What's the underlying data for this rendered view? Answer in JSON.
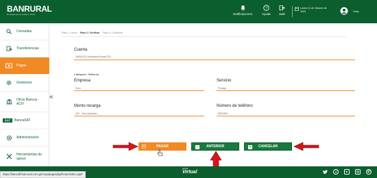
{
  "header": {
    "logo_text": "BANRURAL",
    "logo_tagline": "El amigo que te ayuda a crecer",
    "notifications_label": "Notificaciones",
    "help_label": "Ayuda",
    "logout_label": "Salir",
    "date_text": "Lunes 12 de Octubre de 2020",
    "greeting": "Hola,"
  },
  "sidebar": {
    "items": [
      {
        "label": "Consultas",
        "icon": "search-icon",
        "active": false
      },
      {
        "label": "Transferencias",
        "icon": "transfer-icon",
        "active": false
      },
      {
        "label": "Pagos",
        "icon": "money-icon",
        "active": true
      },
      {
        "label": "Gestiones",
        "icon": "gear-icon",
        "active": false
      },
      {
        "label": "Otros Bancos - ACH",
        "icon": "bank-icon",
        "active": false
      },
      {
        "label": "BancaSAT",
        "icon": "sat-logo-icon",
        "active": false
      },
      {
        "label": "Administración",
        "icon": "admin-gear-icon",
        "active": false
      },
      {
        "label": "Herramientas de apoyo",
        "icon": "tools-icon",
        "active": false
      }
    ]
  },
  "steps": {
    "step1": "Paso 1 / Inicio",
    "step2": "Paso 2 / Verificar",
    "step3": "Paso 3 / Confirmar"
  },
  "form": {
    "cuenta_label": "Cuenta",
    "cuenta_value": "3445010211 Monetaria Privada GTQ",
    "categoria_label": "Categoría: Telefonía",
    "empresa_label": "Empresa",
    "empresa_value": "Claro",
    "servicio_label": "Servicio",
    "servicio_value": "Prepago",
    "monto_label": "Monto recarga",
    "monto_value": "Q10 - Claro Quetzales",
    "telefono_label": "Número de teléfono",
    "telefono_value": "55243344"
  },
  "buttons": {
    "pay": "PAGAR",
    "previous": "ANTERIOR",
    "cancel": "CANCELAR"
  },
  "footer": {
    "status_url": "https://bancaff.banrural.com.gt/corp/pages/jsp/home/index.jsp#",
    "brand": "Virtual",
    "brand_small": "banca"
  },
  "colors": {
    "brand_green": "#0b5e2e",
    "accent_orange": "#f08a24",
    "arrow_red": "#d4161b"
  }
}
